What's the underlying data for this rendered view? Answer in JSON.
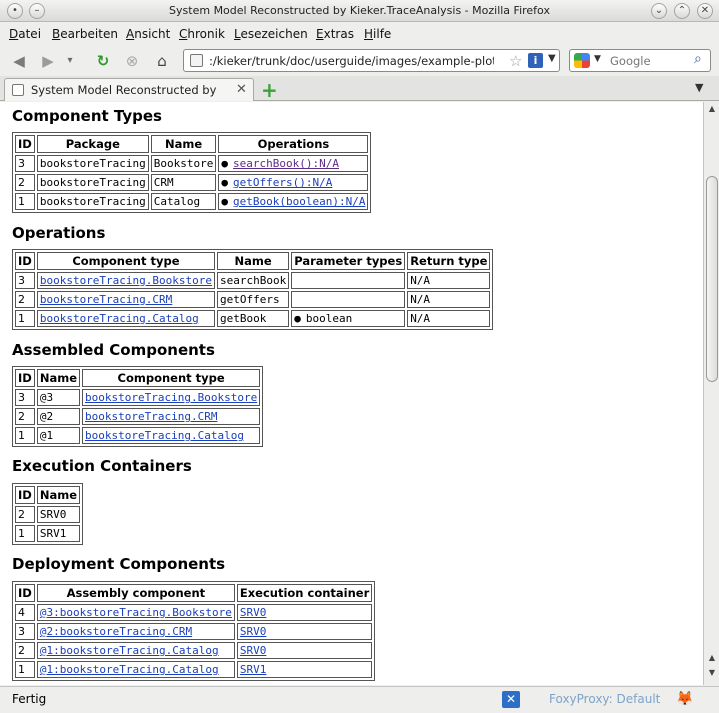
{
  "window": {
    "title": "System Model Reconstructed by Kieker.TraceAnalysis - Mozilla Firefox"
  },
  "menu": [
    {
      "label": "Datei",
      "accel": "D",
      "rest": "atei"
    },
    {
      "label": "Bearbeiten",
      "accel": "B",
      "rest": "earbeiten"
    },
    {
      "label": "Ansicht",
      "accel": "A",
      "rest": "nsicht"
    },
    {
      "label": "Chronik",
      "accel": "C",
      "rest": "hronik"
    },
    {
      "label": "Lesezeichen",
      "accel": "L",
      "rest": "esezeichen"
    },
    {
      "label": "Extras",
      "accel": "E",
      "rest": "xtras"
    },
    {
      "label": "Hilfe",
      "accel": "H",
      "rest": "ilfe"
    }
  ],
  "nav": {
    "url": ":/kieker/trunk/doc/userguide/images/example-plots/",
    "search_placeholder": "Google"
  },
  "tab": {
    "label": "System Model Reconstructed by Kie..."
  },
  "sections": {
    "component_types": {
      "title": "Component Types",
      "headers": [
        "ID",
        "Package",
        "Name",
        "Operations"
      ],
      "rows": [
        {
          "id": "3",
          "package": "bookstoreTracing",
          "name": "Bookstore",
          "operation": "searchBook():N/A"
        },
        {
          "id": "2",
          "package": "bookstoreTracing",
          "name": "CRM",
          "operation": "getOffers():N/A"
        },
        {
          "id": "1",
          "package": "bookstoreTracing",
          "name": "Catalog",
          "operation": "getBook(boolean):N/A"
        }
      ]
    },
    "operations": {
      "title": "Operations",
      "headers": [
        "ID",
        "Component type",
        "Name",
        "Parameter types",
        "Return type"
      ],
      "rows": [
        {
          "id": "3",
          "component": "bookstoreTracing.Bookstore",
          "name": "searchBook",
          "params": "",
          "ret": "N/A"
        },
        {
          "id": "2",
          "component": "bookstoreTracing.CRM",
          "name": "getOffers",
          "params": "",
          "ret": "N/A"
        },
        {
          "id": "1",
          "component": "bookstoreTracing.Catalog",
          "name": "getBook",
          "params": "boolean",
          "ret": "N/A"
        }
      ]
    },
    "assembled": {
      "title": "Assembled Components",
      "headers": [
        "ID",
        "Name",
        "Component type"
      ],
      "rows": [
        {
          "id": "3",
          "name": "@3",
          "component": "bookstoreTracing.Bookstore"
        },
        {
          "id": "2",
          "name": "@2",
          "component": "bookstoreTracing.CRM"
        },
        {
          "id": "1",
          "name": "@1",
          "component": "bookstoreTracing.Catalog"
        }
      ]
    },
    "containers": {
      "title": "Execution Containers",
      "headers": [
        "ID",
        "Name"
      ],
      "rows": [
        {
          "id": "2",
          "name": "SRV0"
        },
        {
          "id": "1",
          "name": "SRV1"
        }
      ]
    },
    "deployment": {
      "title": "Deployment Components",
      "headers": [
        "ID",
        "Assembly component",
        "Execution container"
      ],
      "rows": [
        {
          "id": "4",
          "assembly": "@3:bookstoreTracing.Bookstore",
          "container": "SRV0"
        },
        {
          "id": "3",
          "assembly": "@2:bookstoreTracing.CRM",
          "container": "SRV0"
        },
        {
          "id": "2",
          "assembly": "@1:bookstoreTracing.Catalog",
          "container": "SRV0"
        },
        {
          "id": "1",
          "assembly": "@1:bookstoreTracing.Catalog",
          "container": "SRV1"
        }
      ]
    }
  },
  "status": {
    "text": "Fertig",
    "foxyproxy": "FoxyProxy: Default"
  }
}
